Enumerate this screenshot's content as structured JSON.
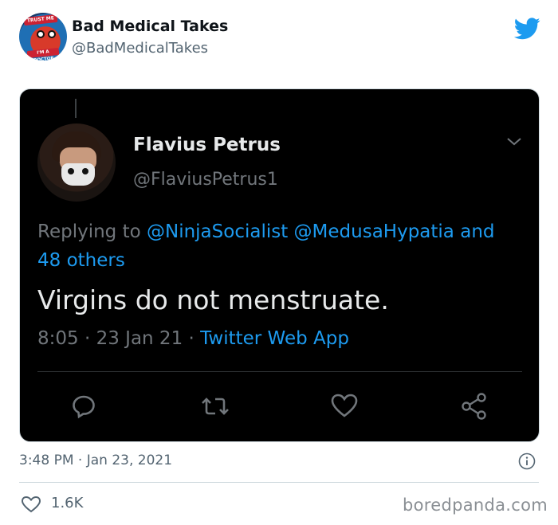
{
  "author": {
    "display_name": "Bad Medical Takes",
    "handle": "@BadMedicalTakes",
    "avatar_text_top": "TRUST ME",
    "avatar_text_bottom": "I'M A DOCTOR"
  },
  "quoted_tweet": {
    "display_name": "Flavius Petrus",
    "handle": "@FlaviusPetrus1",
    "replying_prefix": "Replying to ",
    "replying_to_1": "@NinjaSocialist",
    "replying_to_2": "@MedusaHypatia",
    "replying_suffix": "and 48 others",
    "text": "Virgins do not menstruate.",
    "time": "8:05",
    "date": "23 Jan 21",
    "app": "Twitter Web App",
    "separator": " · "
  },
  "footer": {
    "timestamp": "3:48 PM · Jan 23, 2021",
    "likes": "1.6K"
  },
  "watermark": "boredpanda.com",
  "colors": {
    "accent": "#1d9bf0",
    "twitter_blue": "#1d9bf0",
    "dark_bg": "#000000"
  }
}
